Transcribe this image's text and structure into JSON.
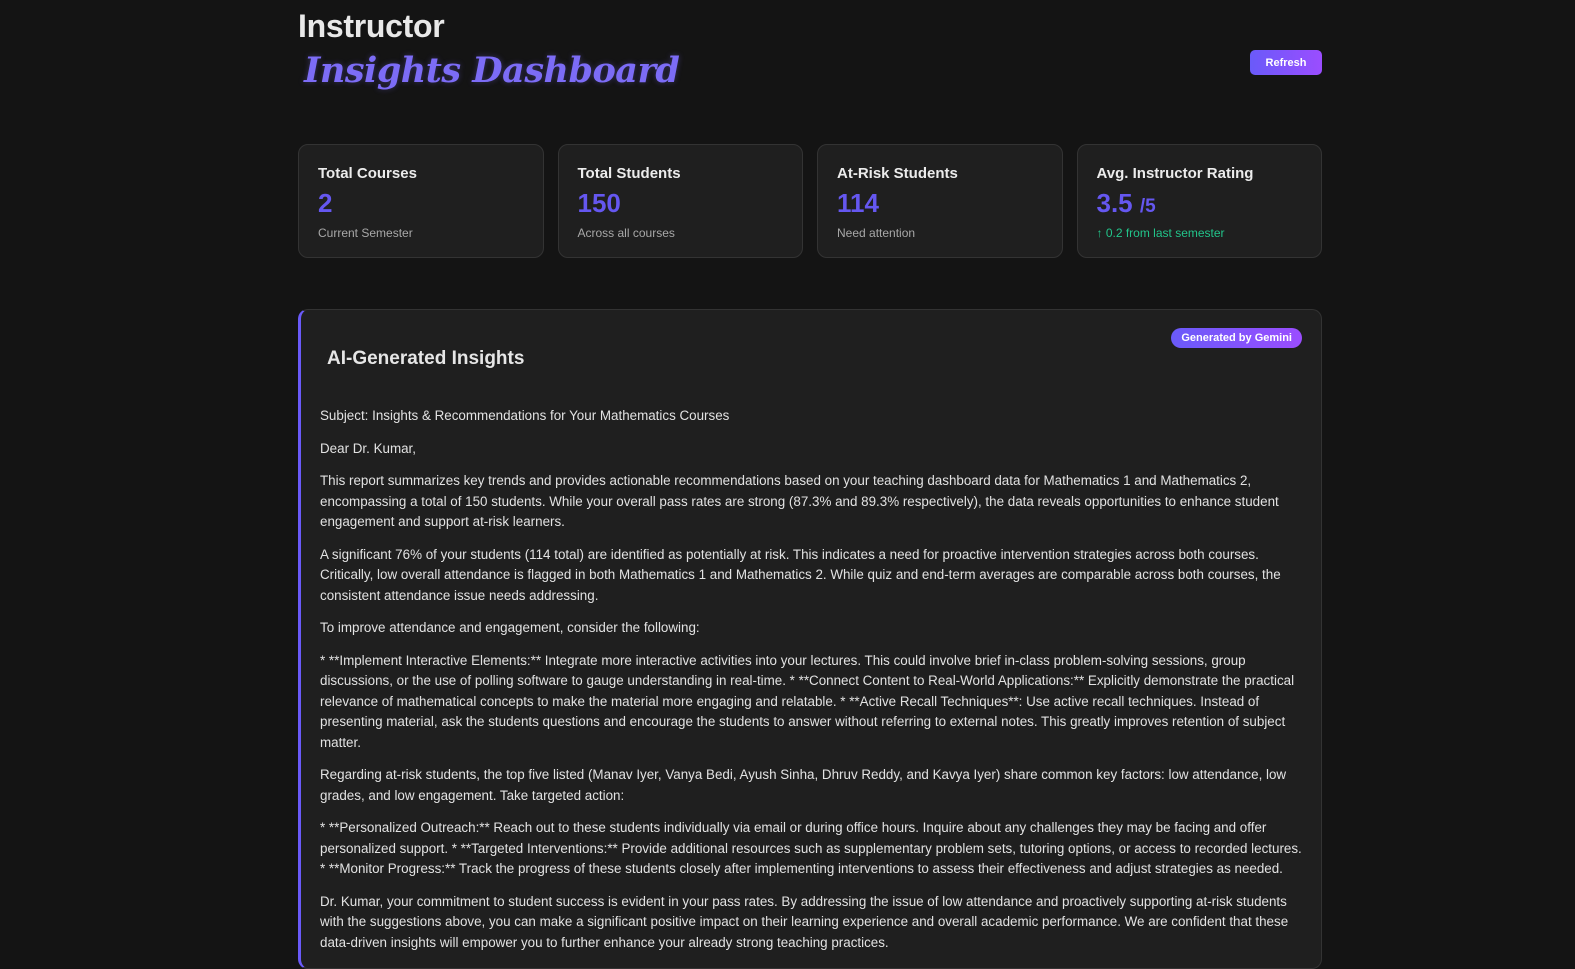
{
  "header": {
    "title": "Instructor",
    "subtitle": "Insights Dashboard",
    "refresh_label": "Refresh"
  },
  "stats": [
    {
      "label": "Total Courses",
      "value": "2",
      "suffix": "",
      "sub": "Current Semester"
    },
    {
      "label": "Total Students",
      "value": "150",
      "suffix": "",
      "sub": "Across all courses"
    },
    {
      "label": "At-Risk Students",
      "value": "114",
      "suffix": "",
      "sub": "Need attention"
    },
    {
      "label": "Avg. Instructor Rating",
      "value": "3.5",
      "suffix": "/5",
      "sub": "↑ 0.2 from last semester"
    }
  ],
  "insights": {
    "title": "AI-Generated Insights",
    "badge": "Generated by Gemini",
    "paragraphs": [
      "Subject: Insights & Recommendations for Your Mathematics Courses",
      "Dear Dr. Kumar,",
      "This report summarizes key trends and provides actionable recommendations based on your teaching dashboard data for Mathematics 1 and Mathematics 2, encompassing a total of 150 students. While your overall pass rates are strong (87.3% and 89.3% respectively), the data reveals opportunities to enhance student engagement and support at-risk learners.",
      "A significant 76% of your students (114 total) are identified as potentially at risk. This indicates a need for proactive intervention strategies across both courses. Critically, low overall attendance is flagged in both Mathematics 1 and Mathematics 2. While quiz and end-term averages are comparable across both courses, the consistent attendance issue needs addressing.",
      "To improve attendance and engagement, consider the following:",
      "* **Implement Interactive Elements:** Integrate more interactive activities into your lectures. This could involve brief in-class problem-solving sessions, group discussions, or the use of polling software to gauge understanding in real-time. * **Connect Content to Real-World Applications:** Explicitly demonstrate the practical relevance of mathematical concepts to make the material more engaging and relatable. * **Active Recall Techniques**: Use active recall techniques. Instead of presenting material, ask the students questions and encourage the students to answer without referring to external notes. This greatly improves retention of subject matter.",
      "Regarding at-risk students, the top five listed (Manav Iyer, Vanya Bedi, Ayush Sinha, Dhruv Reddy, and Kavya Iyer) share common key factors: low attendance, low grades, and low engagement. Take targeted action:",
      "* **Personalized Outreach:** Reach out to these students individually via email or during office hours. Inquire about any challenges they may be facing and offer personalized support. * **Targeted Interventions:** Provide additional resources such as supplementary problem sets, tutoring options, or access to recorded lectures. * **Monitor Progress:** Track the progress of these students closely after implementing interventions to assess their effectiveness and adjust strategies as needed.",
      "Dr. Kumar, your commitment to student success is evident in your pass rates. By addressing the issue of low attendance and proactively supporting at-risk students with the suggestions above, you can make a significant positive impact on their learning experience and overall academic performance. We are confident that these data-driven insights will empower you to further enhance your already strong teaching practices."
    ]
  },
  "colors": {
    "background": "#141414",
    "card": "#1f1f1f",
    "accent": "#6557f0",
    "accent_gradient_end": "#9b4dff",
    "positive": "#22c48a"
  }
}
